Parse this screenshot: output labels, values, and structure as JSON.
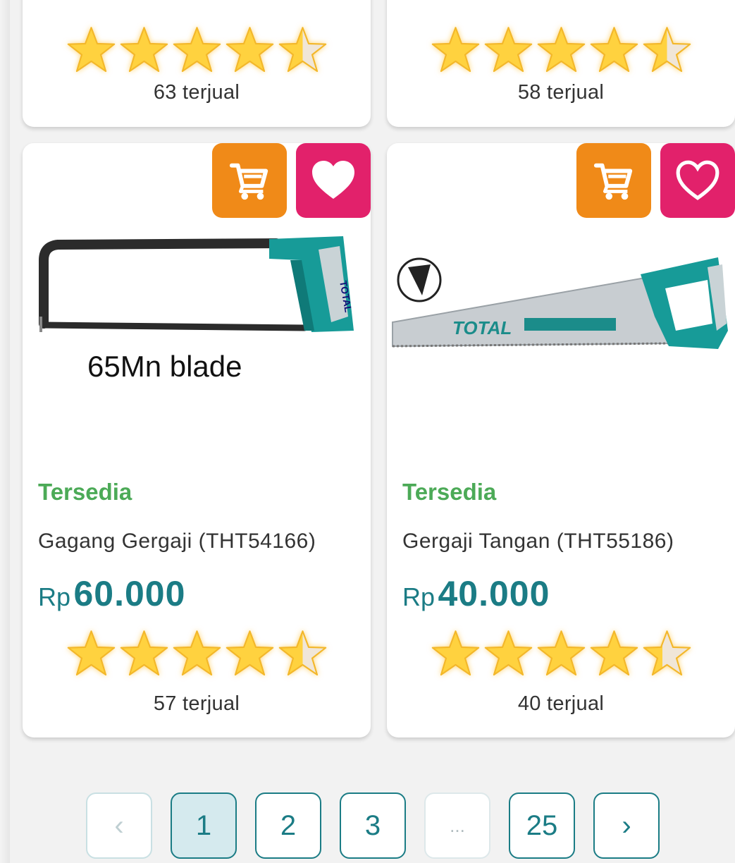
{
  "top_row": [
    {
      "rating": 4.5,
      "sold": "63 terjual"
    },
    {
      "rating": 4.5,
      "sold": "58 terjual"
    }
  ],
  "products": [
    {
      "image_caption": "65Mn blade",
      "status": "Tersedia",
      "name": "Gagang Gergaji (THT54166)",
      "currency": "Rp",
      "price": "60.000",
      "rating": 4.5,
      "sold": "57 terjual"
    },
    {
      "image_brand": "TOTAL",
      "status": "Tersedia",
      "name": "Gergaji Tangan (THT55186)",
      "currency": "Rp",
      "price": "40.000",
      "rating": 4.4,
      "sold": "40 terjual"
    }
  ],
  "pagination": {
    "prev": "‹",
    "pages": [
      "1",
      "2",
      "3"
    ],
    "ellipsis": "...",
    "last": "25",
    "next": "›",
    "current": "1"
  },
  "colors": {
    "status_green": "#4caa57",
    "price_teal": "#1b7c85",
    "cart_orange": "#f08a18",
    "favorite_pink": "#e2216b",
    "star_yellow": "#ffd23f"
  },
  "icons": [
    "cart-icon",
    "heart-icon",
    "star-icon",
    "chevron-left-icon",
    "chevron-right-icon"
  ]
}
